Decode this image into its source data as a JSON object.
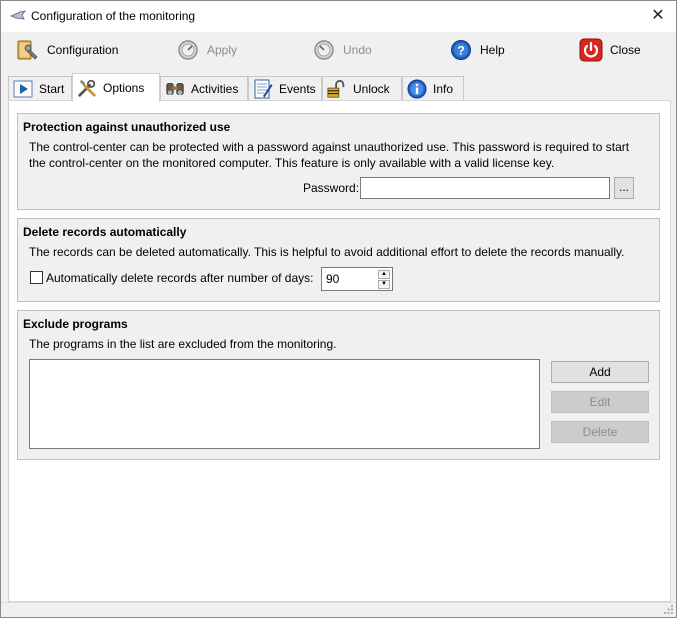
{
  "window": {
    "title": "Configuration of the monitoring",
    "close_glyph": "✕"
  },
  "toolbar": {
    "configuration": "Configuration",
    "apply": "Apply",
    "undo": "Undo",
    "help": "Help",
    "close": "Close"
  },
  "tabs": {
    "start": "Start",
    "options": "Options",
    "activities": "Activities",
    "events": "Events",
    "unlock": "Unlock",
    "info": "Info"
  },
  "protection": {
    "title": "Protection against unauthorized use",
    "line1": "The control-center can be protected with a password against unauthorized use. This password is required to start",
    "line2": "the control-center on the monitored computer. This feature is only available with a valid license key.",
    "password_label": "Password:",
    "password_value": "",
    "browse_label": "..."
  },
  "delete_records": {
    "title": "Delete records automatically",
    "description": "The records can be deleted automatically. This is helpful to avoid additional effort to delete the records manually.",
    "checkbox_label": "Automatically delete records after number of days:",
    "checked": false,
    "days_value": "90"
  },
  "exclude": {
    "title": "Exclude programs",
    "description": "The programs in the list are excluded from the monitoring.",
    "items": [],
    "add_label": "Add",
    "edit_label": "Edit",
    "delete_label": "Delete"
  },
  "colors": {
    "close_red": "#d9261c",
    "help_blue": "#1e5fbf",
    "info_blue": "#1f63c9",
    "disabled_text": "#8c8c8c"
  },
  "icons": {
    "configuration": "folder-wrench-icon",
    "apply": "gauge-icon",
    "undo": "gauge-icon",
    "help": "help-icon",
    "close": "power-icon",
    "start": "play-icon",
    "options": "tools-icon",
    "activities": "binoculars-icon",
    "events": "notepad-icon",
    "unlock": "padlock-icon",
    "info": "info-icon"
  }
}
